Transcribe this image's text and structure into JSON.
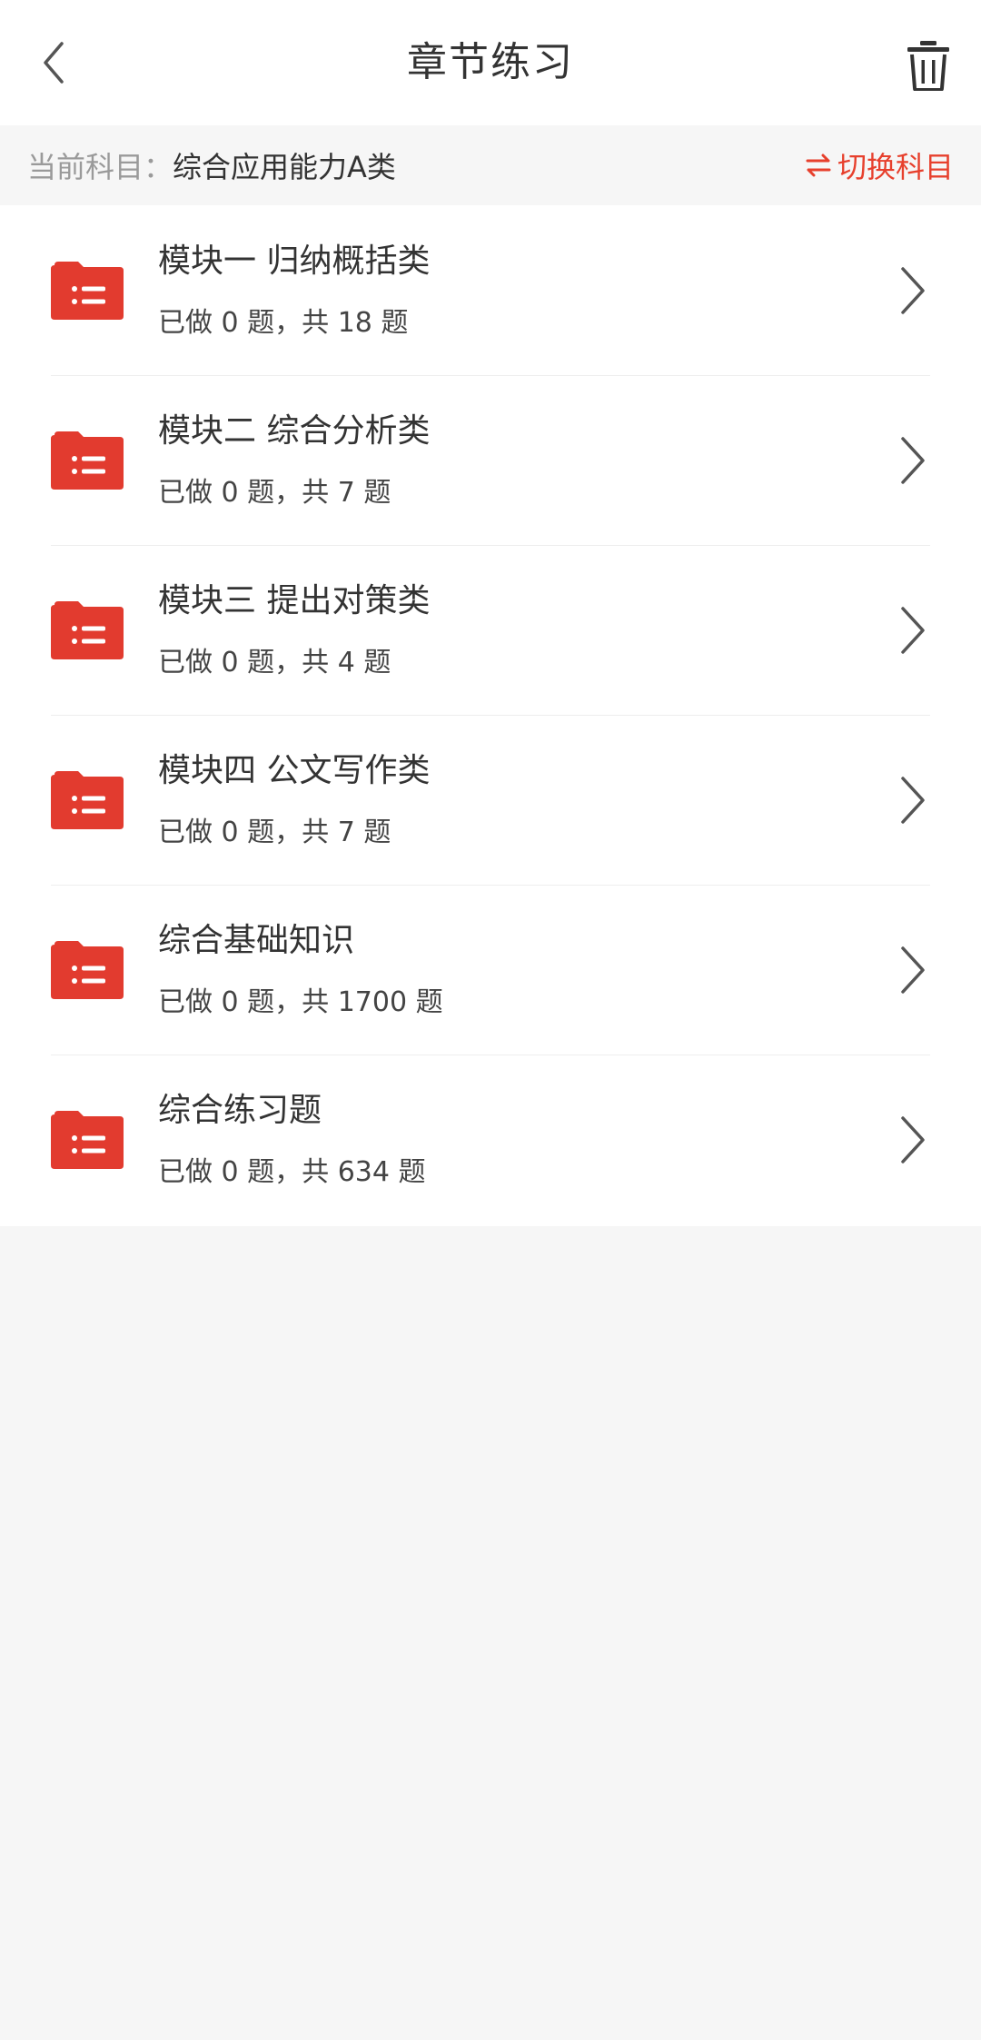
{
  "header": {
    "title": "章节练习"
  },
  "subject": {
    "label": "当前科目：",
    "value": "综合应用能力A类",
    "switch_label": "切换科目"
  },
  "items": [
    {
      "title": "模块一 归纳概括类",
      "sub": "已做 0 题，共 18 题"
    },
    {
      "title": "模块二 综合分析类",
      "sub": "已做 0 题，共 7 题"
    },
    {
      "title": "模块三 提出对策类",
      "sub": "已做 0 题，共 4 题"
    },
    {
      "title": "模块四 公文写作类",
      "sub": "已做 0 题，共 7 题"
    },
    {
      "title": "综合基础知识",
      "sub": "已做 0 题，共 1700 题"
    },
    {
      "title": "综合练习题",
      "sub": "已做 0 题，共 634 题"
    }
  ],
  "colors": {
    "accent": "#e7402d",
    "folder": "#e23b2f"
  }
}
